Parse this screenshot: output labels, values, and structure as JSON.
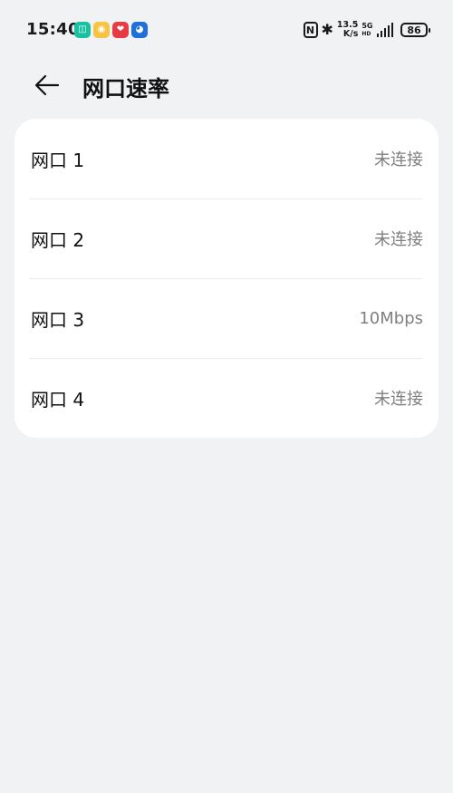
{
  "status_bar": {
    "time": "15:40",
    "apps": [
      {
        "name": "mi-home",
        "glyph": "◫"
      },
      {
        "name": "weibo",
        "glyph": "◉"
      },
      {
        "name": "heart-app",
        "glyph": "❤"
      },
      {
        "name": "robot-app",
        "glyph": "◕"
      }
    ],
    "nfc": "N",
    "bluetooth": "✱",
    "speed_value": "13.5",
    "speed_unit": "K/s",
    "network_type": "5G",
    "network_sub": "HD",
    "battery": "86"
  },
  "header": {
    "title": "网口速率"
  },
  "ports": [
    {
      "label": "网口 1",
      "value": "未连接"
    },
    {
      "label": "网口 2",
      "value": "未连接"
    },
    {
      "label": "网口 3",
      "value": "10Mbps"
    },
    {
      "label": "网口 4",
      "value": "未连接"
    }
  ]
}
